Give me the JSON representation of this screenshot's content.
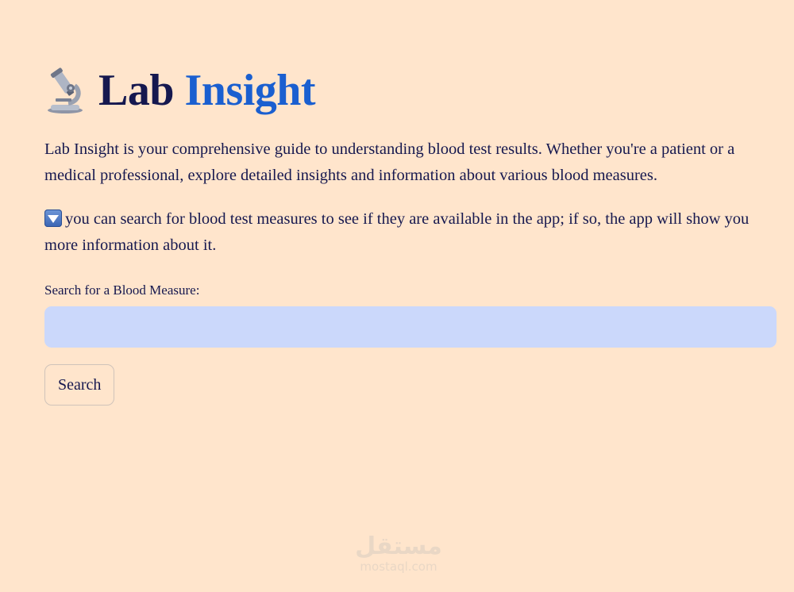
{
  "header": {
    "icon": "microscope-icon",
    "title_part1": "Lab",
    "title_part2": "Insight"
  },
  "intro": {
    "text": "Lab Insight is your comprehensive guide to understanding blood test results. Whether you're a patient or a medical professional, explore detailed insights and information about various blood measures."
  },
  "hint": {
    "icon": "down-arrow-button-icon",
    "text": "you can search for blood test measures to see if they are available in the app; if so, the app will show you more information about it."
  },
  "search": {
    "label": "Search for a Blood Measure:",
    "value": "",
    "placeholder": "",
    "button_label": "Search"
  },
  "watermark": {
    "logo_text": "مستقل",
    "url": "mostaql.com"
  },
  "colors": {
    "background": "#ffe5cc",
    "text": "#16184f",
    "accent": "#1a5fd0",
    "input_background": "#cbd8fb"
  }
}
